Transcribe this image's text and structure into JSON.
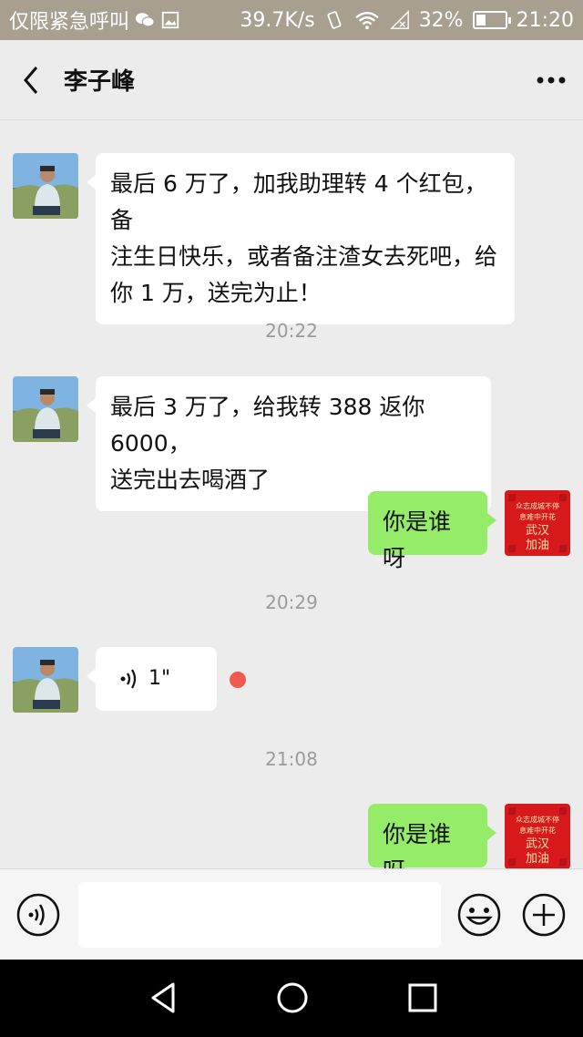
{
  "status_bar": {
    "carrier_text": "仅限紧急呼叫",
    "network_speed": "39.7K/s",
    "battery_percent": "32%",
    "time": "21:20",
    "battery_level": 0.32,
    "icons": [
      "wechat-icon",
      "image-icon",
      "vibrate-icon",
      "wifi-icon",
      "no-signal-icon",
      "battery-icon"
    ]
  },
  "header": {
    "title": "李子峰",
    "back_icon": "chevron-left-icon",
    "more_icon": "more-dots-icon"
  },
  "messages": [
    {
      "type": "text",
      "direction": "in",
      "text_lines": [
        "最后 6 万了，加我助理转 4 个红包，备",
        "注生日快乐，或者备注渣女去死吧，给",
        "你 1 万，送完为止！"
      ]
    },
    {
      "type": "time",
      "text": "20:22"
    },
    {
      "type": "text",
      "direction": "in",
      "text_lines": [
        "最后 3 万了，给我转 388 返你 6000，",
        "送完出去喝酒了"
      ]
    },
    {
      "type": "text",
      "direction": "out",
      "text": "你是谁呀"
    },
    {
      "type": "time",
      "text": "20:29"
    },
    {
      "type": "voice",
      "direction": "in",
      "duration": "1\"",
      "unread": true
    },
    {
      "type": "time",
      "text": "21:08"
    },
    {
      "type": "text",
      "direction": "out",
      "text": "你是谁呀"
    }
  ],
  "self_avatar": {
    "lines": [
      "众志成城不停",
      "息难中开花",
      "武汉",
      "加油"
    ],
    "bg_color": "#d7191c"
  },
  "input_bar": {
    "placeholder": "",
    "voice_icon": "voice-mode-icon",
    "emoji_icon": "emoji-icon",
    "plus_icon": "plus-icon"
  },
  "nav_bar": {
    "icons": [
      "back-triangle-icon",
      "home-circle-icon",
      "recents-square-icon"
    ]
  },
  "colors": {
    "status_bar_bg": "#a89f8e",
    "chat_bg": "#ececec",
    "incoming_bubble": "#ffffff",
    "outgoing_bubble": "#95ec69",
    "unread_dot": "#f25a4f",
    "time_text": "#9b9b9b"
  }
}
